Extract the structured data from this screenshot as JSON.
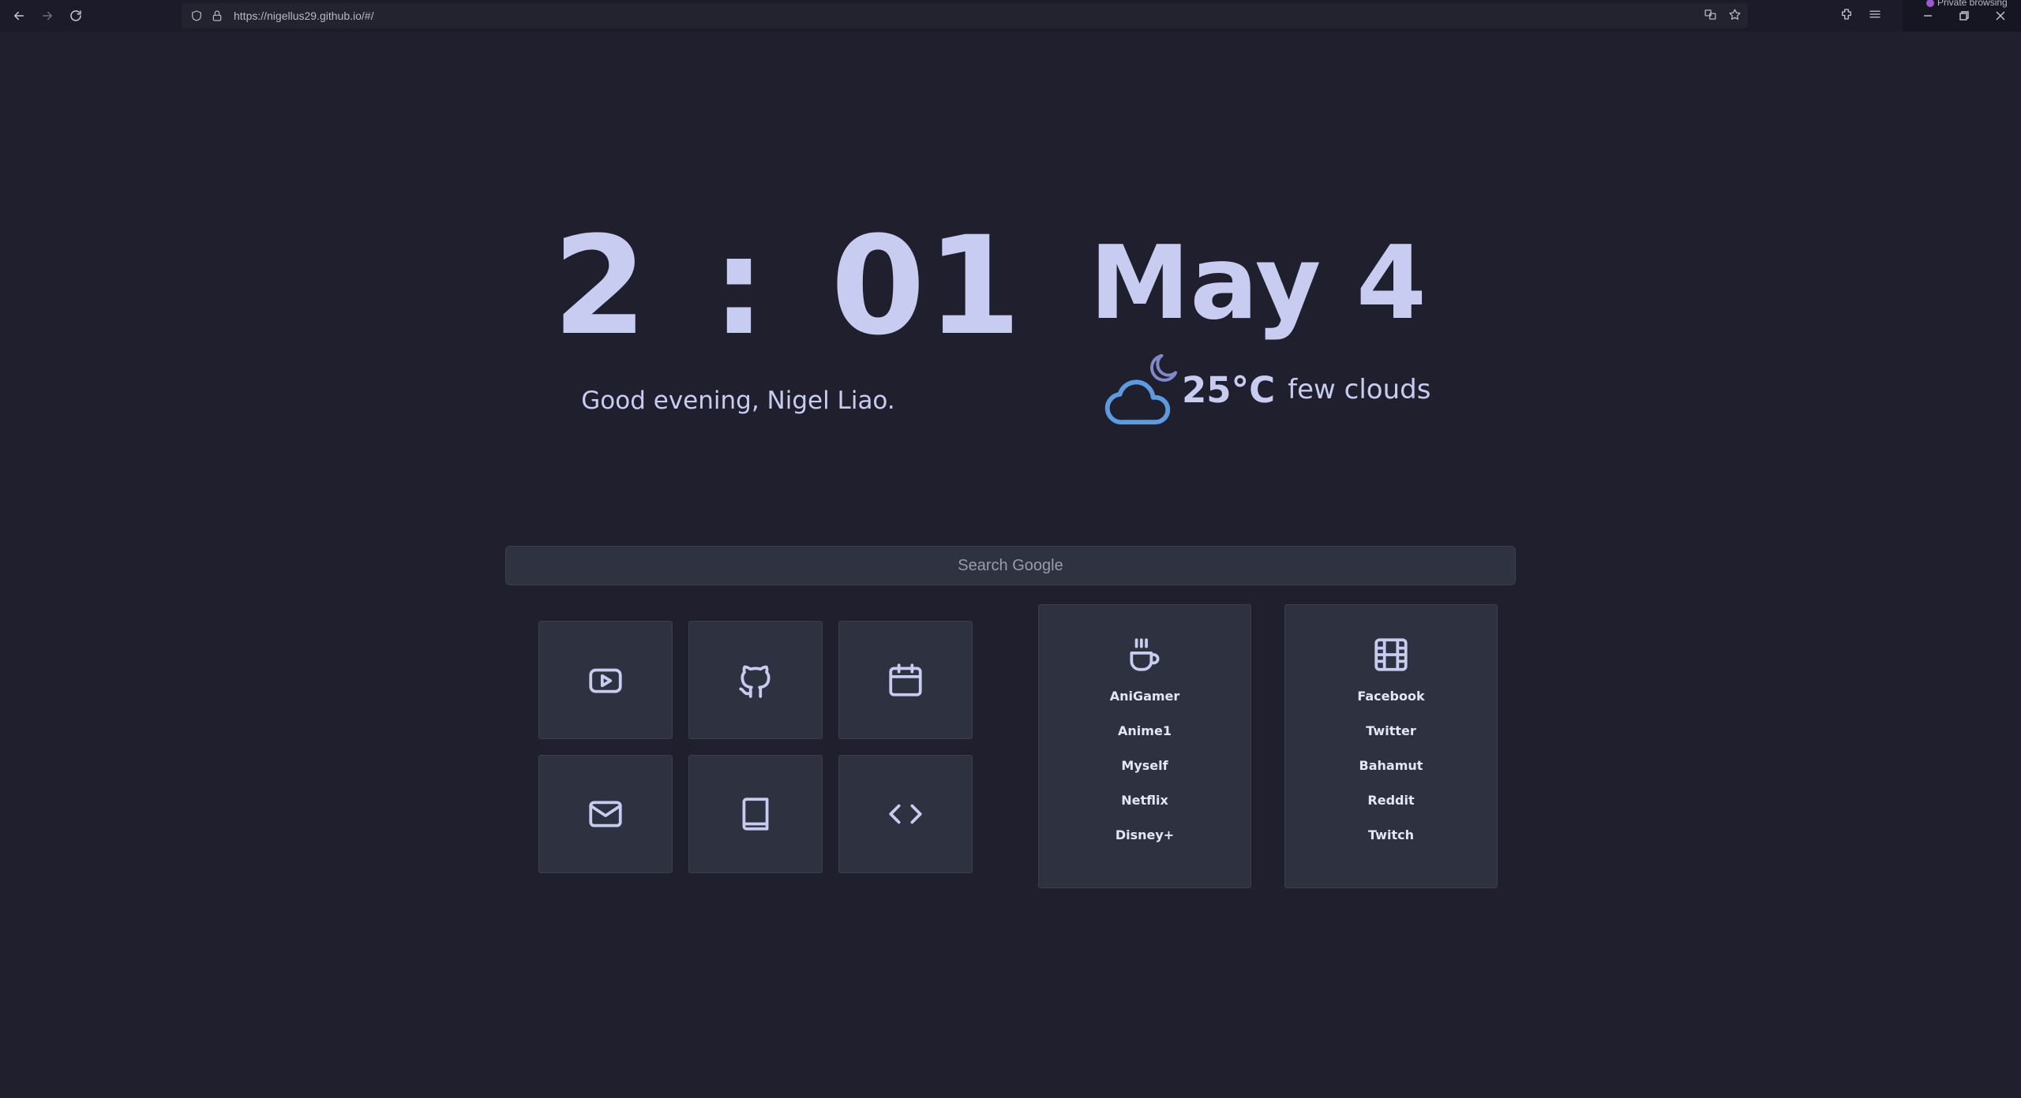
{
  "browser": {
    "url": "https://nigellus29.github.io/#/",
    "private_label": "Private browsing"
  },
  "clock": {
    "hours": "2",
    "separator": ":",
    "minutes": "01"
  },
  "greeting": "Good evening, Nigel Liao.",
  "date": "May 4",
  "weather": {
    "temperature": "25°C",
    "description": "few clouds",
    "icon": "cloud-moon-icon"
  },
  "search": {
    "placeholder": "Search Google"
  },
  "tiles": [
    {
      "name": "youtube",
      "icon": "play-icon"
    },
    {
      "name": "github",
      "icon": "github-icon"
    },
    {
      "name": "calendar",
      "icon": "calendar-icon"
    },
    {
      "name": "mail",
      "icon": "mail-icon"
    },
    {
      "name": "book",
      "icon": "book-icon"
    },
    {
      "name": "code",
      "icon": "code-icon"
    }
  ],
  "cards": {
    "anime": {
      "icon": "coffee-cup-icon",
      "links": [
        "AniGamer",
        "Anime1",
        "Myself",
        "Netflix",
        "Disney+"
      ]
    },
    "social": {
      "icon": "film-icon",
      "links": [
        "Facebook",
        "Twitter",
        "Bahamut",
        "Reddit",
        "Twitch"
      ]
    }
  },
  "colors": {
    "background": "#1f1f2e",
    "panel": "#2e3240",
    "text": "#c8ccf0",
    "weather_icon": "#5d9bde"
  }
}
